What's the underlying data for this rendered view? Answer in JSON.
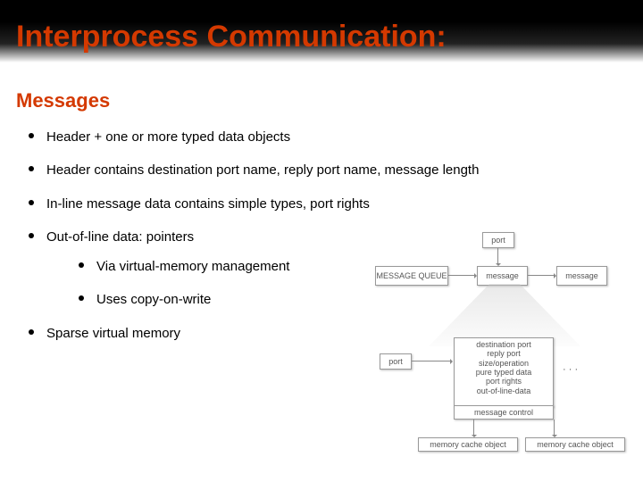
{
  "title": "Interprocess Communication:",
  "subtitle": "Messages",
  "bullets": [
    "Header + one or more typed data objects",
    "Header contains destination port name, reply port name, message length",
    "In-line message data contains simple types, port rights",
    "Out-of-line data: pointers",
    "Sparse virtual memory"
  ],
  "subbullets_index": 3,
  "subbullets": [
    "Via virtual-memory management",
    "Uses copy-on-write"
  ],
  "diagram": {
    "port_top": "port",
    "message_queue": "MESSAGE QUEUE",
    "message1": "message",
    "message2": "message",
    "port_left": "port",
    "detail_lines": [
      "destination port",
      "reply port",
      "size/operation",
      "pure typed data",
      "port rights",
      "out-of-line-data"
    ],
    "dots": "· · ·",
    "message_control": "message control",
    "mem_obj1": "memory cache object",
    "mem_obj2": "memory cache object"
  }
}
